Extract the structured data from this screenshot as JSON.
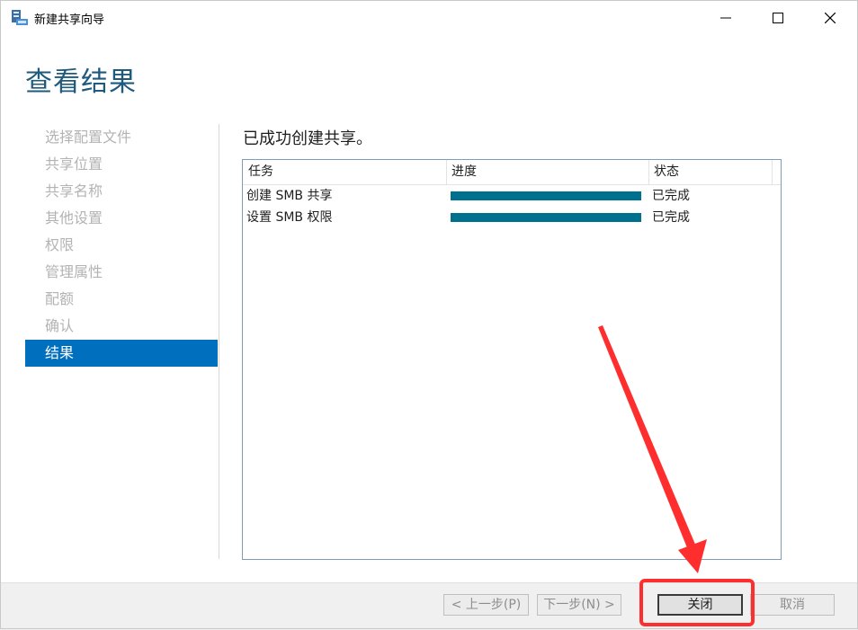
{
  "window": {
    "title": "新建共享向导"
  },
  "page": {
    "heading": "查看结果",
    "result_text": "已成功创建共享。"
  },
  "steps": [
    {
      "label": "选择配置文件",
      "active": false
    },
    {
      "label": "共享位置",
      "active": false
    },
    {
      "label": "共享名称",
      "active": false
    },
    {
      "label": "其他设置",
      "active": false
    },
    {
      "label": "权限",
      "active": false
    },
    {
      "label": "管理属性",
      "active": false
    },
    {
      "label": "配额",
      "active": false
    },
    {
      "label": "确认",
      "active": false
    },
    {
      "label": "结果",
      "active": true
    }
  ],
  "table": {
    "columns": {
      "task": "任务",
      "progress": "进度",
      "status": "状态"
    },
    "rows": [
      {
        "task": "创建 SMB 共享",
        "progress": 1.0,
        "status": "已完成"
      },
      {
        "task": "设置 SMB 权限",
        "progress": 1.0,
        "status": "已完成"
      }
    ]
  },
  "buttons": {
    "prev": "< 上一步(P)",
    "next": "下一步(N) >",
    "close": "关闭",
    "cancel": "取消"
  },
  "colors": {
    "accent": "#006fbd",
    "heading": "#1e5a7d",
    "progress": "#00708f",
    "annotation": "#ff2e2e"
  },
  "icons": [
    "app-share-wizard-icon",
    "minimize-icon",
    "maximize-icon",
    "close-icon"
  ]
}
